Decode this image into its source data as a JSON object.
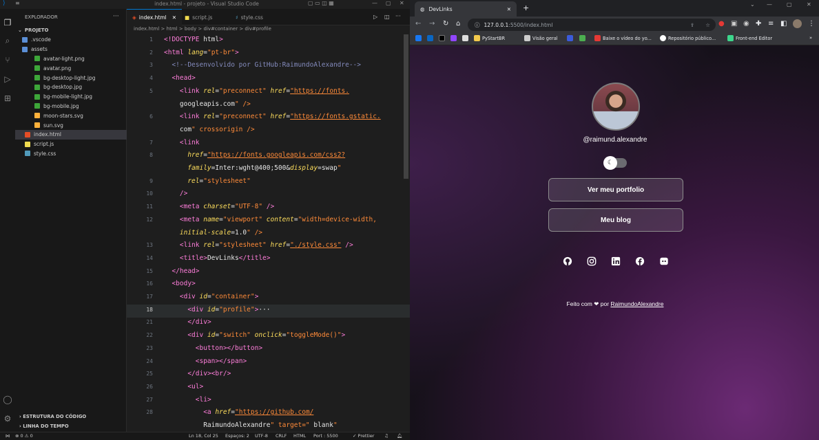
{
  "vscode": {
    "window_title": "index.html - projeto - Visual Studio Code",
    "explorer_label": "EXPLORADOR",
    "project_label": "PROJETO",
    "tree": [
      {
        "label": ".vscode",
        "kind": "folder"
      },
      {
        "label": "assets",
        "kind": "folder-open"
      },
      {
        "label": "avatar-light.png",
        "kind": "image"
      },
      {
        "label": "avatar.png",
        "kind": "image"
      },
      {
        "label": "bg-desktop-light.jpg",
        "kind": "image"
      },
      {
        "label": "bg-desktop.jpg",
        "kind": "image"
      },
      {
        "label": "bg-mobile-light.jpg",
        "kind": "image"
      },
      {
        "label": "bg-mobile.jpg",
        "kind": "image"
      },
      {
        "label": "moon-stars.svg",
        "kind": "svg"
      },
      {
        "label": "sun.svg",
        "kind": "svg"
      },
      {
        "label": "index.html",
        "kind": "html"
      },
      {
        "label": "script.js",
        "kind": "js"
      },
      {
        "label": "style.css",
        "kind": "css"
      }
    ],
    "outline_label": "ESTRUTURA DO CÓDIGO",
    "timeline_label": "LINHA DO TEMPO",
    "tabs": [
      "index.html",
      "script.js",
      "style.css"
    ],
    "breadcrumb": "index.html > html > body > div#container > div#profile",
    "line_numbers": [
      "1",
      "2",
      "3",
      "4",
      "5",
      "",
      "6",
      "",
      "7",
      "8",
      "",
      "9",
      "10",
      "11",
      "12",
      "",
      "13",
      "14",
      "15",
      "16",
      "17",
      "18",
      "21",
      "22",
      "23",
      "24",
      "25",
      "26",
      "27",
      "28",
      ""
    ],
    "code_lines": [
      "<!DOCTYPE html>",
      "<html lang=\"pt-br\">",
      "  <!--Desenvolvido por GitHub:RaimundoAlexandre-->",
      "  <head>",
      "    <link rel=\"preconnect\" href=\"https://fonts.",
      "    googleapis.com\" />",
      "    <link rel=\"preconnect\" href=\"https://fonts.gstatic.",
      "    com\" crossorigin />",
      "    <link",
      "      href=\"https://fonts.googleapis.com/css2?",
      "      family=Inter:wght@400;500&display=swap\"",
      "      rel=\"stylesheet\"",
      "    />",
      "    <meta charset=\"UTF-8\" />",
      "    <meta name=\"viewport\" content=\"width=device-width,",
      "    initial-scale=1.0\" />",
      "    <link rel=\"stylesheet\" href=\"./style.css\" />",
      "    <title>DevLinks</title>",
      "  </head>",
      "  <body>",
      "    <div id=\"container\">",
      "      <div id=\"profile\">···",
      "      </div>",
      "      <div id=\"switch\" onclick=\"toggleMode()\">",
      "        <button></button>",
      "        <span></span>",
      "      </div><br/>",
      "      <ul>",
      "        <li>",
      "          <a href=\"https://github.com/",
      "          RaimundoAlexandre\" target=\" blank\""
    ],
    "status": {
      "errors": "⊗ 0 ⚠ 0",
      "position": "Ln 18, Col 25",
      "spaces": "Espaços: 2",
      "encoding": "UTF-8",
      "eol": "CRLF",
      "language": "HTML",
      "port": "Port : 5500",
      "prettier": "✓ Prettier"
    },
    "colors": {
      "accent": "#0078d4",
      "tag": "#ff7edb",
      "attr": "#fede5d",
      "string": "#ff8b39",
      "comment": "#848bbd"
    }
  },
  "browser": {
    "tab_title": "DevLinks",
    "url_host": "127.0.0.1",
    "url_rest": ":5500/index.html",
    "bookmarks": [
      "PyStartBR",
      "Visão geral",
      "Baixe o vídeo do yo...",
      "Repositório público...",
      "Front-end Editor"
    ]
  },
  "page": {
    "handle": "@raimund.alexandre",
    "buttons": [
      "Ver meu portfolio",
      "Meu blog"
    ],
    "socials": [
      "github-icon",
      "instagram-icon",
      "linkedin-icon",
      "facebook-icon",
      "discord-icon"
    ],
    "footer_prefix": "Feito com",
    "footer_by": "por",
    "footer_author": "RaimundoAlexandre"
  }
}
